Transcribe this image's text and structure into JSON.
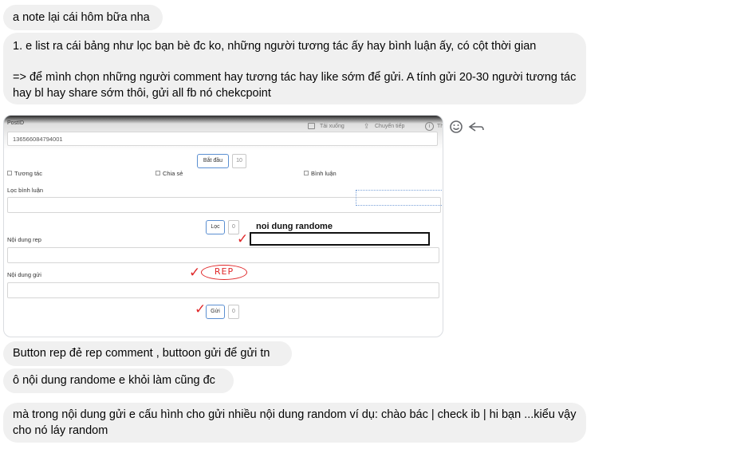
{
  "messages": [
    {
      "text": "a note lại cái hôm bữa nha"
    },
    {
      "lines": [
        "1. e list  ra cái bảng như lọc bạn bè đc ko, những người tương tác ấy hay bình luận ấy, có cột thời gian",
        "",
        "=> để mình chọn những người comment hay tương tác hay like sớm để gửi. A tính gửi 20-30 người tương tác hay bl hay share sớm thôi, gửi all fb nó chekcpoint"
      ]
    },
    {
      "text": "Button rep đẻ rep comment , buttoon gửi để gửi tn"
    },
    {
      "text": "ô nội dung randome e khỏi làm cũng đc"
    },
    {
      "text": "mà trong nội dung gửi e cấu hình cho gửi nhiều nội dung random ví dụ: chào bác | check ib | hi bạn ...kiểu vậy cho nó láy random"
    }
  ],
  "screenshot": {
    "postid_label": "PostID",
    "postid_value": "136566084794001",
    "download_label": "Tải xuống",
    "forward_label": "Chuyển tiếp",
    "info_label": "Th",
    "start_button": "Bắt đầu",
    "start_count": "10",
    "check_interact": "Tương tác",
    "check_share": "Chia sẻ",
    "check_comment": "Bình luận",
    "filter_comment_label": "Lọc bình luận",
    "filter_button": "Lọc",
    "filter_count": "0",
    "rep_content_label": "Nội dung rep",
    "send_content_label": "Nội dung gửi",
    "send_button": "Gửi",
    "send_count": "0",
    "annotation_random": "noi dung randome",
    "annotation_rep": "REP"
  },
  "icons": [
    "smile-icon",
    "reply-icon",
    "download-icon",
    "forward-icon",
    "info-icon"
  ]
}
